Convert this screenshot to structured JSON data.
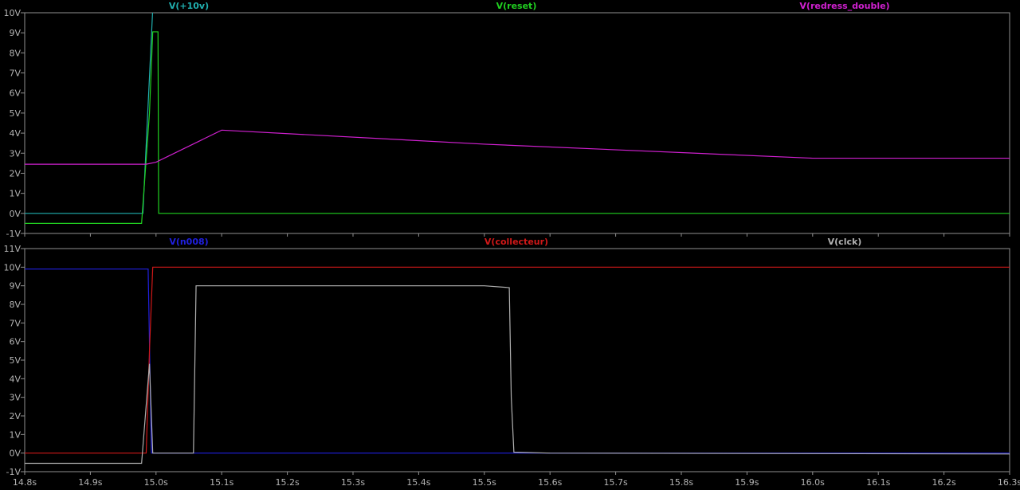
{
  "chart_data": [
    {
      "type": "line",
      "pane": "top",
      "xlim": [
        14.8,
        16.3
      ],
      "ylim": [
        -1,
        10
      ],
      "yticks": [
        "-1V",
        "0V",
        "1V",
        "2V",
        "3V",
        "4V",
        "5V",
        "6V",
        "7V",
        "8V",
        "9V",
        "10V"
      ],
      "grid": false,
      "series": [
        {
          "name": "V(+10v)",
          "color": "#20b0b0",
          "x": [
            14.8,
            14.98,
            14.995,
            15.5,
            16.3
          ],
          "y": [
            0,
            0,
            10.2,
            10.2,
            10.2
          ]
        },
        {
          "name": "V(reset)",
          "color": "#20d020",
          "x": [
            14.8,
            14.978,
            14.99,
            14.995,
            15.003,
            15.004,
            16.3
          ],
          "y": [
            -0.5,
            -0.5,
            5.0,
            9.05,
            9.05,
            0,
            0
          ]
        },
        {
          "name": "V(redress_double)",
          "color": "#d020d0",
          "x": [
            14.8,
            14.985,
            15.0,
            15.1,
            15.5,
            16.0,
            16.3
          ],
          "y": [
            2.45,
            2.45,
            2.55,
            4.15,
            3.45,
            2.75,
            2.75
          ]
        }
      ]
    },
    {
      "type": "line",
      "pane": "bottom",
      "xlim": [
        14.8,
        16.3
      ],
      "ylim": [
        -1,
        11
      ],
      "yticks": [
        "-1V",
        "0V",
        "1V",
        "2V",
        "3V",
        "4V",
        "5V",
        "6V",
        "7V",
        "8V",
        "9V",
        "10V",
        "11V"
      ],
      "xticks": [
        "14.8s",
        "14.9s",
        "15.0s",
        "15.1s",
        "15.2s",
        "15.3s",
        "15.4s",
        "15.5s",
        "15.6s",
        "15.7s",
        "15.8s",
        "15.9s",
        "16.0s",
        "16.1s",
        "16.2s",
        "16.3s"
      ],
      "grid": false,
      "series": [
        {
          "name": "V(n008)",
          "color": "#2020e0",
          "x": [
            14.8,
            14.988,
            14.993,
            15.06,
            15.6,
            16.3
          ],
          "y": [
            9.9,
            9.9,
            0,
            0,
            0,
            0
          ]
        },
        {
          "name": "V(collecteur)",
          "color": "#d01818",
          "x": [
            14.8,
            14.985,
            14.99,
            14.995,
            16.3
          ],
          "y": [
            0,
            0,
            5.5,
            10,
            10
          ]
        },
        {
          "name": "V(clck)",
          "color": "#b0b0b0",
          "x": [
            14.8,
            14.978,
            14.99,
            14.995,
            15.057,
            15.061,
            15.5,
            15.538,
            15.541,
            15.545,
            15.6,
            16.3
          ],
          "y": [
            -0.55,
            -0.55,
            4.8,
            0,
            0,
            9.0,
            9.0,
            8.9,
            3.0,
            0.05,
            0,
            -0.05
          ]
        }
      ]
    }
  ]
}
